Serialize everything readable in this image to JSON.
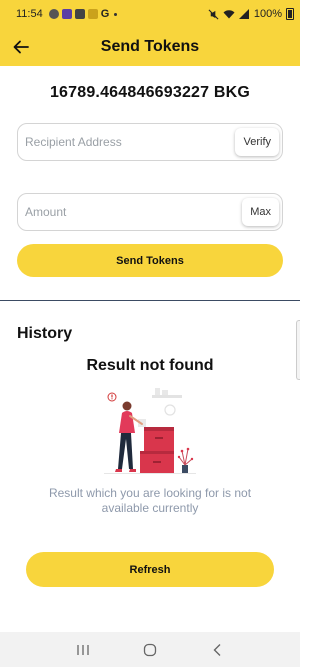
{
  "status_bar": {
    "time": "11:54",
    "battery": "100%"
  },
  "header": {
    "title": "Send Tokens",
    "back_icon": "arrow-left-icon"
  },
  "wallet": {
    "balance": "16789.464846693227 BKG"
  },
  "form": {
    "recipient_placeholder": "Recipient Address",
    "verify_label": "Verify",
    "amount_placeholder": "Amount",
    "max_label": "Max",
    "send_label": "Send Tokens"
  },
  "history": {
    "title": "History",
    "empty_title": "Result not found",
    "empty_description": "Result which you are looking for is not available currently",
    "refresh_label": "Refresh"
  },
  "colors": {
    "accent": "#f8d53c",
    "muted_text": "#8e99ab",
    "divider": "#3b4b63"
  }
}
